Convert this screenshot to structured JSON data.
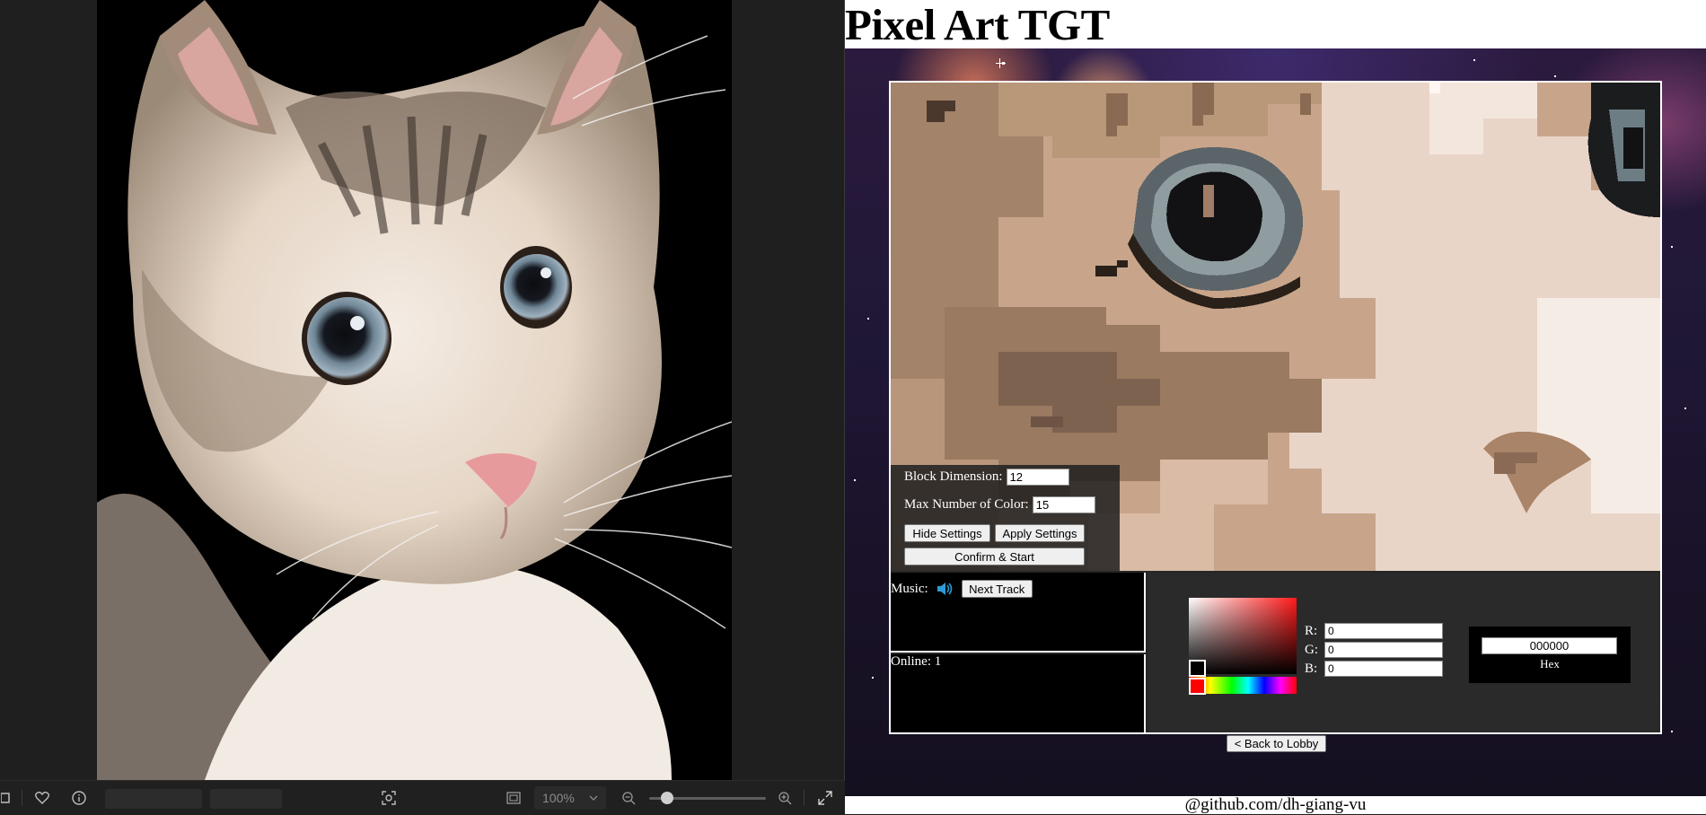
{
  "viewer": {
    "zoom_level": "100%",
    "icons": [
      "film-strip-icon",
      "heart-icon",
      "info-icon",
      "face-detect-icon",
      "fit-screen-icon",
      "zoom-out-icon",
      "zoom-in-icon",
      "expand-icon"
    ],
    "zoom_slider_value": 0.15
  },
  "app": {
    "title": "Pixel Art TGT",
    "settings": {
      "block_dimension_label": "Block Dimension:",
      "block_dimension_value": "12",
      "max_colors_label": "Max Number of Color:",
      "max_colors_value": "15",
      "hide_settings_label": "Hide Settings",
      "apply_settings_label": "Apply Settings",
      "confirm_start_label": "Confirm & Start"
    },
    "music": {
      "label": "Music:",
      "next_track_label": "Next Track",
      "icon": "speaker-icon"
    },
    "online": {
      "label": "Online: 1"
    },
    "color_picker": {
      "r_label": "R:",
      "g_label": "G:",
      "b_label": "B:",
      "r_value": "0",
      "g_value": "0",
      "b_value": "0",
      "hex_value": "000000",
      "hex_label": "Hex",
      "current_color": "#000000",
      "hue_color": "#ff0000"
    },
    "back_to_lobby_label": "< Back to Lobby",
    "footer_credit": "@github.com/dh-giang-vu"
  }
}
